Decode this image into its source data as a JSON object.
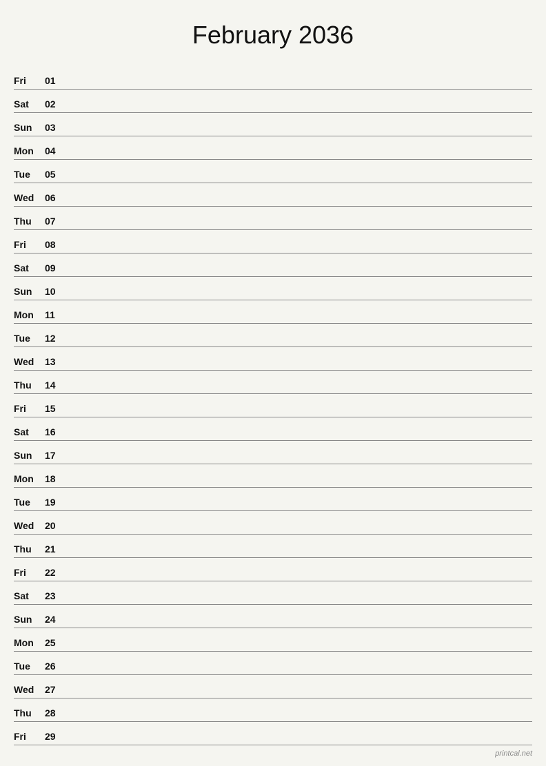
{
  "title": "February 2036",
  "watermark": "printcal.net",
  "days": [
    {
      "name": "Fri",
      "num": "01"
    },
    {
      "name": "Sat",
      "num": "02"
    },
    {
      "name": "Sun",
      "num": "03"
    },
    {
      "name": "Mon",
      "num": "04"
    },
    {
      "name": "Tue",
      "num": "05"
    },
    {
      "name": "Wed",
      "num": "06"
    },
    {
      "name": "Thu",
      "num": "07"
    },
    {
      "name": "Fri",
      "num": "08"
    },
    {
      "name": "Sat",
      "num": "09"
    },
    {
      "name": "Sun",
      "num": "10"
    },
    {
      "name": "Mon",
      "num": "11"
    },
    {
      "name": "Tue",
      "num": "12"
    },
    {
      "name": "Wed",
      "num": "13"
    },
    {
      "name": "Thu",
      "num": "14"
    },
    {
      "name": "Fri",
      "num": "15"
    },
    {
      "name": "Sat",
      "num": "16"
    },
    {
      "name": "Sun",
      "num": "17"
    },
    {
      "name": "Mon",
      "num": "18"
    },
    {
      "name": "Tue",
      "num": "19"
    },
    {
      "name": "Wed",
      "num": "20"
    },
    {
      "name": "Thu",
      "num": "21"
    },
    {
      "name": "Fri",
      "num": "22"
    },
    {
      "name": "Sat",
      "num": "23"
    },
    {
      "name": "Sun",
      "num": "24"
    },
    {
      "name": "Mon",
      "num": "25"
    },
    {
      "name": "Tue",
      "num": "26"
    },
    {
      "name": "Wed",
      "num": "27"
    },
    {
      "name": "Thu",
      "num": "28"
    },
    {
      "name": "Fri",
      "num": "29"
    }
  ]
}
